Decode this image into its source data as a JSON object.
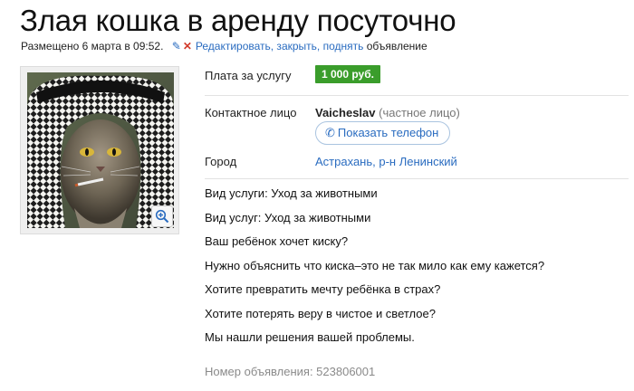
{
  "title": "Злая кошка в аренду посуточно",
  "meta": {
    "posted": "Размещено 6 марта в 09:52.",
    "edit_links": "Редактировать, закрыть, поднять",
    "suffix": " объявление"
  },
  "details": {
    "price_label": "Плата за услугу",
    "price_value": "1 000 руб.",
    "contact_label": "Контактное лицо",
    "contact_name": "Vaicheslav",
    "contact_type": " (частное лицо)",
    "phone_button": "Показать телефон",
    "city_label": "Город",
    "city_value": "Астрахань, р-н Ленинский"
  },
  "description": [
    "Вид услуги: Уход за животными",
    "Вид услуг: Уход за животными",
    "Ваш ребёнок хочет киску?",
    "Нужно объяснить что киска–это не так мило как ему кажется?",
    "Хотите превратить мечту ребёнка в страх?",
    "Хотите потерять веру в чистое и светлое?",
    "Мы нашли решения вашей проблемы."
  ],
  "ad_number": "Номер объявления: 523806001",
  "colors": {
    "link": "#2a6cc0",
    "price_bg": "#3a9d2b",
    "delete": "#d23b2b"
  },
  "icons": [
    "pencil-icon",
    "delete-icon",
    "zoom-icon",
    "phone-icon"
  ]
}
